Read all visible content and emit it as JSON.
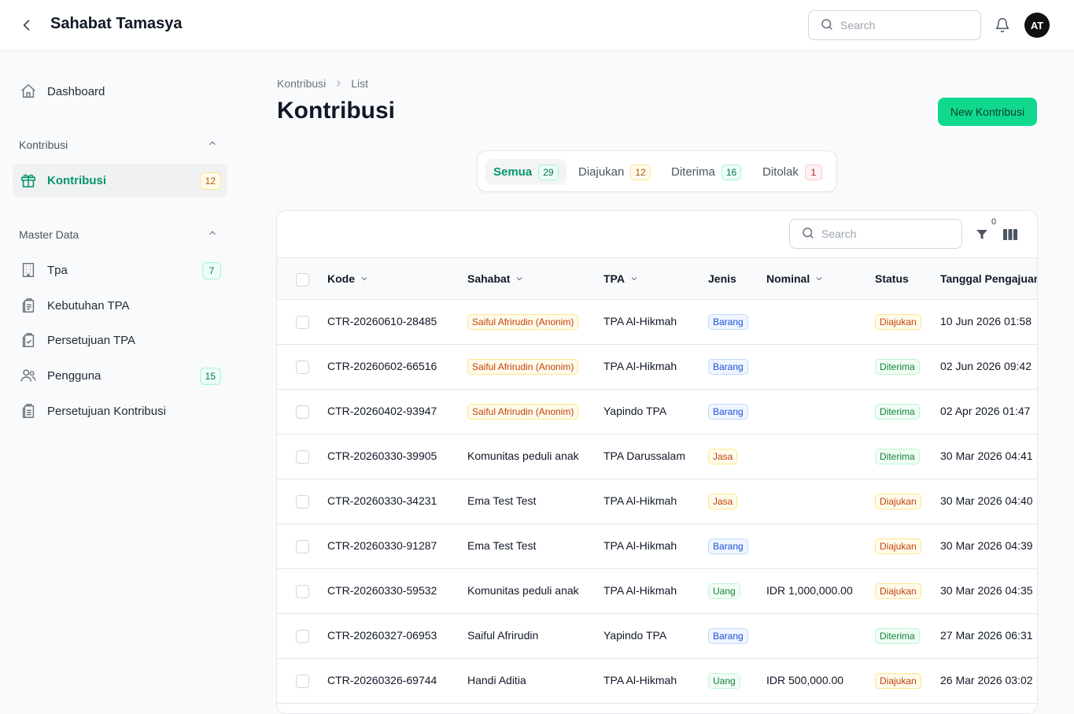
{
  "app": {
    "title": "Sahabat Tamasya",
    "user_initials": "AT"
  },
  "topbar": {
    "search_placeholder": "Search"
  },
  "sidebar": {
    "dashboard": "Dashboard",
    "groups": {
      "kontribusi": {
        "title": "Kontribusi",
        "items": [
          {
            "label": "Kontribusi",
            "count": "12"
          }
        ]
      },
      "master": {
        "title": "Master Data",
        "items": [
          {
            "label": "Tpa",
            "count": "7"
          },
          {
            "label": "Kebutuhan TPA",
            "count": ""
          },
          {
            "label": "Persetujuan TPA",
            "count": ""
          },
          {
            "label": "Pengguna",
            "count": "15"
          },
          {
            "label": "Persetujuan Kontribusi",
            "count": ""
          }
        ]
      }
    }
  },
  "breadcrumb": {
    "root": "Kontribusi",
    "current": "List"
  },
  "page": {
    "title": "Kontribusi",
    "new_button": "New Kontribusi"
  },
  "tabs": [
    {
      "label": "Semua",
      "count": "29"
    },
    {
      "label": "Diajukan",
      "count": "12"
    },
    {
      "label": "Diterima",
      "count": "16"
    },
    {
      "label": "Ditolak",
      "count": "1"
    }
  ],
  "table": {
    "search_placeholder": "Search",
    "filter_count": "0",
    "columns": [
      "Kode",
      "Sahabat",
      "TPA",
      "Jenis",
      "Nominal",
      "Status",
      "Tanggal Pengajuan"
    ],
    "rows": [
      {
        "kode": "CTR-20260610-28485",
        "sahabat": "Saiful Afrirudin (Anonim)",
        "tpa": "TPA Al-Hikmah",
        "jenis": "Barang",
        "nominal": "",
        "status": "Diajukan",
        "tanggal": "10 Jun 2026 01:58"
      },
      {
        "kode": "CTR-20260602-66516",
        "sahabat": "Saiful Afrirudin (Anonim)",
        "tpa": "TPA Al-Hikmah",
        "jenis": "Barang",
        "nominal": "",
        "status": "Diterima",
        "tanggal": "02 Jun 2026 09:42"
      },
      {
        "kode": "CTR-20260402-93947",
        "sahabat": "Saiful Afrirudin (Anonim)",
        "tpa": "Yapindo TPA",
        "jenis": "Barang",
        "nominal": "",
        "status": "Diterima",
        "tanggal": "02 Apr 2026 01:47"
      },
      {
        "kode": "CTR-20260330-39905",
        "sahabat": "Komunitas peduli anak",
        "tpa": "TPA Darussalam",
        "jenis": "Jasa",
        "nominal": "",
        "status": "Diterima",
        "tanggal": "30 Mar 2026 04:41"
      },
      {
        "kode": "CTR-20260330-34231",
        "sahabat": "Ema Test Test",
        "tpa": "TPA Al-Hikmah",
        "jenis": "Jasa",
        "nominal": "",
        "status": "Diajukan",
        "tanggal": "30 Mar 2026 04:40"
      },
      {
        "kode": "CTR-20260330-91287",
        "sahabat": "Ema Test Test",
        "tpa": "TPA Al-Hikmah",
        "jenis": "Barang",
        "nominal": "",
        "status": "Diajukan",
        "tanggal": "30 Mar 2026 04:39"
      },
      {
        "kode": "CTR-20260330-59532",
        "sahabat": "Komunitas peduli anak",
        "tpa": "TPA Al-Hikmah",
        "jenis": "Uang",
        "nominal": "IDR 1,000,000.00",
        "status": "Diajukan",
        "tanggal": "30 Mar 2026 04:35"
      },
      {
        "kode": "CTR-20260327-06953",
        "sahabat": "Saiful Afrirudin",
        "tpa": "Yapindo TPA",
        "jenis": "Barang",
        "nominal": "",
        "status": "Diterima",
        "tanggal": "27 Mar 2026 06:31"
      },
      {
        "kode": "CTR-20260326-69744",
        "sahabat": "Handi Aditia",
        "tpa": "TPA Al-Hikmah",
        "jenis": "Uang",
        "nominal": "IDR 500,000.00",
        "status": "Diajukan",
        "tanggal": "26 Mar 2026 03:02"
      }
    ]
  },
  "colors": {
    "accent": "#059669",
    "primary_button": "#10d98e"
  }
}
